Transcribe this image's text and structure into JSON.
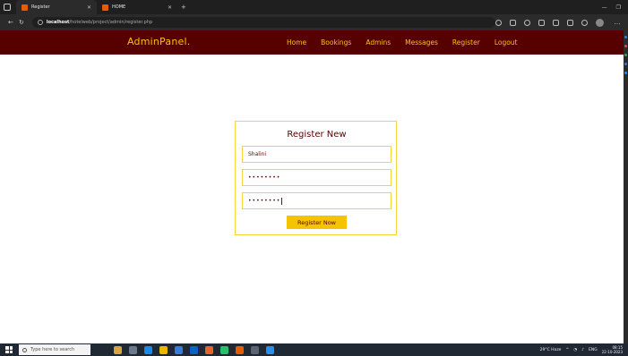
{
  "browser": {
    "tabs": [
      {
        "title": "Register",
        "active": true
      },
      {
        "title": "HOME",
        "active": false
      }
    ],
    "url_host": "localhost",
    "url_path": "/hotelweb/project/admin/register.php"
  },
  "navbar": {
    "brand": "AdminPanel.",
    "links": [
      "Home",
      "Bookings",
      "Admins",
      "Messages",
      "Register",
      "Logout"
    ]
  },
  "form": {
    "title": "Register New",
    "username_value": "Shalini",
    "password_value": "••••••••",
    "confirm_value": "••••••••",
    "submit_label": "Register Now"
  },
  "taskbar": {
    "search_placeholder": "Type here to search",
    "weather": "29°C  Haze",
    "lang": "ENG",
    "time": "08:15",
    "date": "22-10-2023"
  },
  "colors": {
    "brand_dark": "#570000",
    "accent": "#f5c400"
  }
}
